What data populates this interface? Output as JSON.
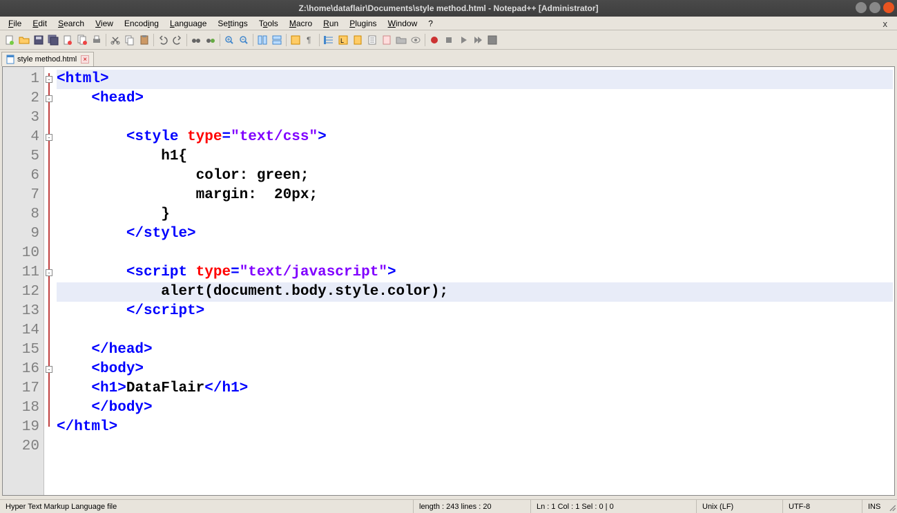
{
  "window": {
    "title": "Z:\\home\\dataflair\\Documents\\style method.html - Notepad++ [Administrator]"
  },
  "menu": {
    "file": "File",
    "edit": "Edit",
    "search": "Search",
    "view": "View",
    "encoding": "Encoding",
    "language": "Language",
    "settings": "Settings",
    "tools": "Tools",
    "macro": "Macro",
    "run": "Run",
    "plugins": "Plugins",
    "window": "Window",
    "help": "?"
  },
  "tab": {
    "name": "style method.html"
  },
  "code": {
    "lines": [
      {
        "n": 1,
        "html": "<span class='t-tag'>&lt;html&gt;</span>",
        "fold": "box",
        "hl": true,
        "indent": 0
      },
      {
        "n": 2,
        "html": "<span class='t-tag'>&lt;head&gt;</span>",
        "fold": "box",
        "indent": 1
      },
      {
        "n": 3,
        "html": "",
        "indent": 0
      },
      {
        "n": 4,
        "html": "<span class='t-tag'>&lt;style</span> <span class='t-attr'>type</span><span class='t-tag'>=</span><span class='t-str'>\"text/css\"</span><span class='t-tag'>&gt;</span>",
        "fold": "box",
        "indent": 2
      },
      {
        "n": 5,
        "html": "<span class='t-css-sel'>h1{</span>",
        "indent": 3
      },
      {
        "n": 6,
        "html": "<span class='t-css-prop'>color: green;</span>",
        "indent": 4
      },
      {
        "n": 7,
        "html": "<span class='t-css-prop'>margin:&nbsp;&nbsp;20px;</span>",
        "indent": 4
      },
      {
        "n": 8,
        "html": "<span class='t-css-sel'>}</span>",
        "indent": 3
      },
      {
        "n": 9,
        "html": "<span class='t-tag'>&lt;/style&gt;</span>",
        "indent": 2
      },
      {
        "n": 10,
        "html": "",
        "indent": 0
      },
      {
        "n": 11,
        "html": "<span class='t-tag'>&lt;script</span> <span class='t-attr'>type</span><span class='t-tag'>=</span><span class='t-str'>\"text/javascript\"</span><span class='t-tag'>&gt;</span>",
        "fold": "box",
        "indent": 2
      },
      {
        "n": 12,
        "html": "<span class='t-js'>alert</span><span class='t-js-punct'>(</span><span class='t-js'>document.body.style.color</span><span class='t-js-punct'>);</span>",
        "hl": true,
        "indent": 3
      },
      {
        "n": 13,
        "html": "<span class='t-tag'>&lt;/script&gt;</span>",
        "indent": 2
      },
      {
        "n": 14,
        "html": "",
        "indent": 0
      },
      {
        "n": 15,
        "html": "<span class='t-tag'>&lt;/head&gt;</span>",
        "indent": 1
      },
      {
        "n": 16,
        "html": "<span class='t-tag'>&lt;body&gt;</span>",
        "fold": "box",
        "indent": 1
      },
      {
        "n": 17,
        "html": "<span class='t-tag'>&lt;h1&gt;</span><span class='t-text'>DataFlair</span><span class='t-tag'>&lt;/h1&gt;</span>",
        "indent": 1
      },
      {
        "n": 18,
        "html": "<span class='t-tag'>&lt;/body&gt;</span>",
        "indent": 1
      },
      {
        "n": 19,
        "html": "<span class='t-tag'>&lt;/html&gt;</span>",
        "indent": 0
      },
      {
        "n": 20,
        "html": "",
        "indent": 0
      }
    ]
  },
  "status": {
    "lang": "Hyper Text Markup Language file",
    "length": "length : 243    lines : 20",
    "pos": "Ln : 1    Col : 1    Sel : 0 | 0",
    "eol": "Unix (LF)",
    "enc": "UTF-8",
    "ins": "INS"
  }
}
